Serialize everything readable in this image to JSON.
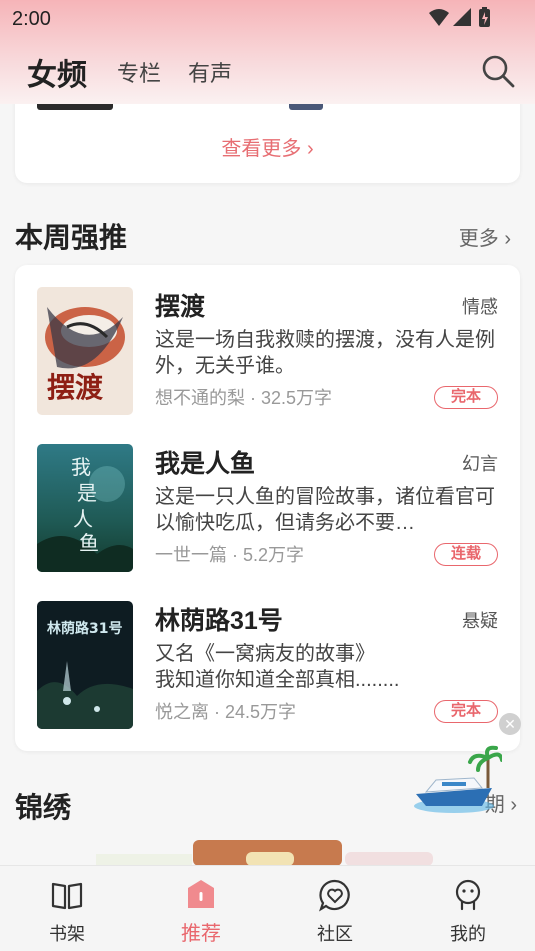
{
  "status_bar": {
    "time": "2:00"
  },
  "header": {
    "tabs": [
      {
        "label": "女频",
        "active": true
      },
      {
        "label": "专栏",
        "active": false
      },
      {
        "label": "有声",
        "active": false
      }
    ],
    "search_icon": "search-icon"
  },
  "previous_section": {
    "more_label": "查看更多 ›"
  },
  "weekly": {
    "title": "本周强推",
    "more_label": "更多 ›",
    "books": [
      {
        "title": "摆渡",
        "genre": "情感",
        "description": "这是一场自我救赎的摆渡，没有人是例外，无关乎谁。",
        "meta": "想不通的梨 · 32.5万字",
        "status": "完本",
        "cover_text": "摆渡"
      },
      {
        "title": "我是人鱼",
        "genre": "幻言",
        "description": "这是一只人鱼的冒险故事，诸位看官可以愉快吃瓜，但请务必不要…",
        "meta": "一世一篇 · 5.2万字",
        "status": "连载",
        "cover_text": "我是人鱼"
      },
      {
        "title": "林荫路31号",
        "genre": "悬疑",
        "description": "又名《一窝病友的故事》\n我知道你知道全部真相........",
        "meta": "悦之离 · 24.5万字",
        "status": "完本",
        "cover_text": "林荫路31号"
      }
    ]
  },
  "next_section": {
    "title": "锦绣",
    "more_label": "期 ›"
  },
  "bottom_nav": [
    {
      "label": "书架",
      "icon": "book-icon",
      "active": false
    },
    {
      "label": "推荐",
      "icon": "recommend-icon",
      "active": true
    },
    {
      "label": "社区",
      "icon": "community-heart-icon",
      "active": false
    },
    {
      "label": "我的",
      "icon": "profile-icon",
      "active": false
    }
  ],
  "colors": {
    "accent": "#e9676d",
    "header_top": "#f6b4b8"
  }
}
